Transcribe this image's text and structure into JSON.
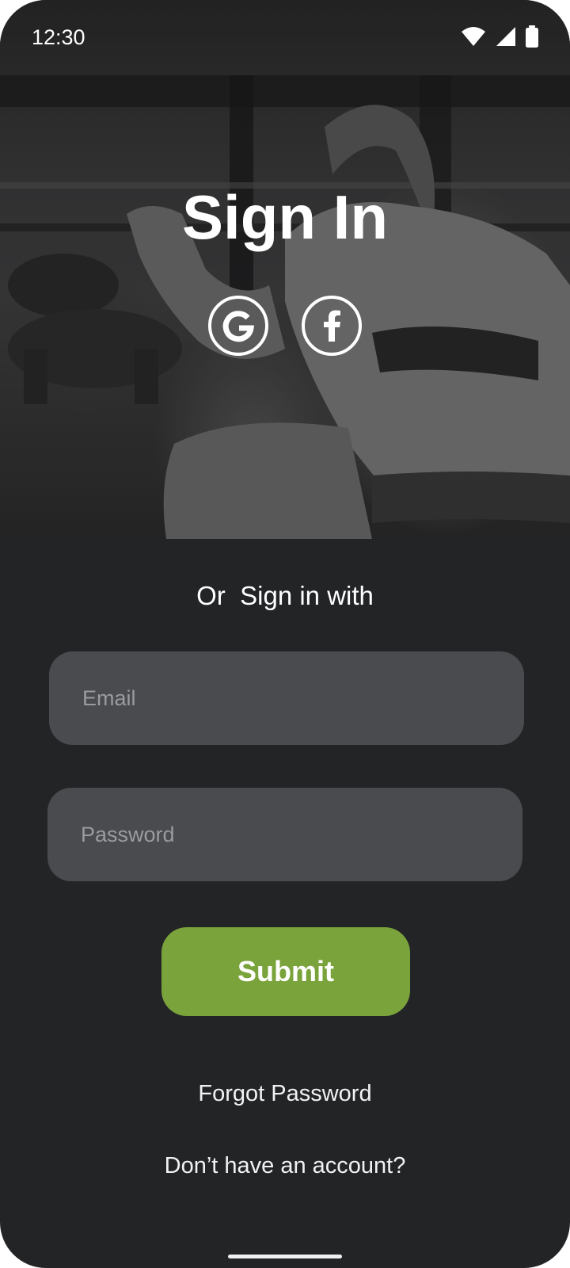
{
  "status_bar": {
    "time": "12:30",
    "icons": [
      "wifi-icon",
      "cellular-signal-icon",
      "battery-icon"
    ]
  },
  "hero": {
    "background": "grayscale gym photo",
    "title": "Sign In"
  },
  "social_login": {
    "buttons": [
      {
        "name": "google-login-button",
        "icon": "google-icon"
      },
      {
        "name": "facebook-login-button",
        "icon": "facebook-icon"
      }
    ]
  },
  "form": {
    "divider_text": "Or  Sign in with",
    "email": {
      "placeholder": "Email",
      "value": ""
    },
    "password": {
      "placeholder": "Password",
      "value": ""
    },
    "submit_label": "Submit"
  },
  "links": {
    "forgot_password": "Forgot Password",
    "signup_prompt": "Don’t have an account?"
  },
  "colors": {
    "background": "#232426",
    "field_background": "#4a4b4e",
    "accent": "#7aa33c",
    "text": "#ffffff"
  }
}
